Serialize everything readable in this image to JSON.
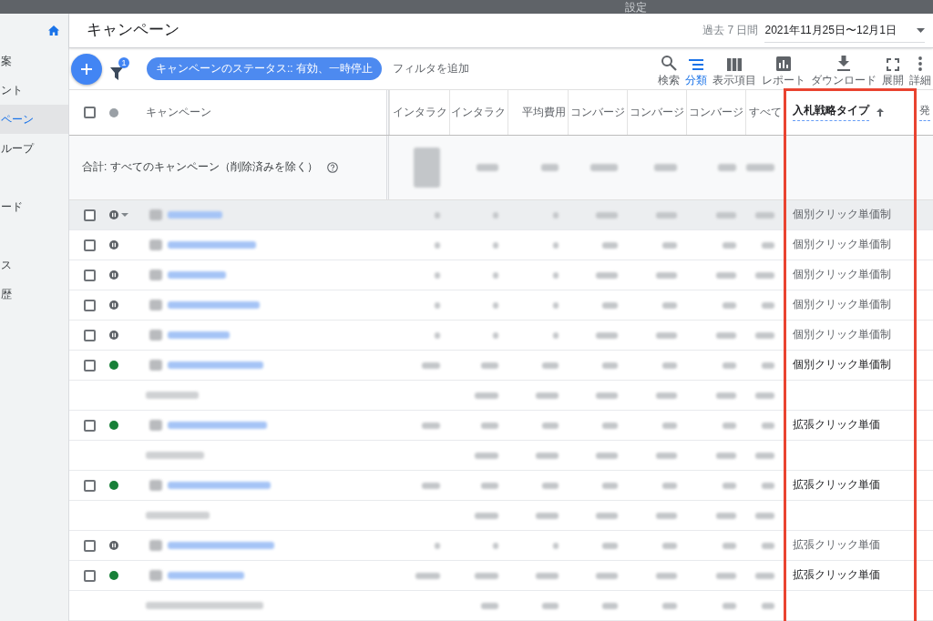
{
  "top_bar": {
    "label": "設定"
  },
  "sidebar": {
    "items": [
      {
        "label": "案",
        "selected": false
      },
      {
        "label": "ント",
        "selected": false
      },
      {
        "label": "ペーン",
        "selected": true
      },
      {
        "label": "ループ",
        "selected": false
      },
      {
        "label": "ード",
        "selected": false
      },
      {
        "label": "ス",
        "selected": false
      },
      {
        "label": "歴",
        "selected": false
      }
    ]
  },
  "header": {
    "title": "キャンペーン",
    "date_range": {
      "preset": "過去 7 日間",
      "value": "2021年11月25日〜12月1日"
    }
  },
  "toolbar": {
    "filter_badge": "1",
    "filter_chip": "キャンペーンのステータス:: 有効、一時停止",
    "add_filter": "フィルタを追加",
    "actions": [
      {
        "kind": "search",
        "label": "検索",
        "selected": false
      },
      {
        "kind": "segment",
        "label": "分類",
        "selected": true
      },
      {
        "kind": "columns",
        "label": "表示項目",
        "selected": false
      },
      {
        "kind": "report",
        "label": "レポート",
        "selected": false
      },
      {
        "kind": "download",
        "label": "ダウンロード",
        "selected": false
      },
      {
        "kind": "expand",
        "label": "展開",
        "selected": false
      },
      {
        "kind": "more",
        "label": "詳細",
        "selected": false
      }
    ]
  },
  "table": {
    "select_all": {
      "checked": false
    },
    "columns": [
      {
        "kind": "name",
        "label": "キャンペーン",
        "sorted": false,
        "help": false,
        "highlighted": false
      },
      {
        "kind": "metric",
        "label": "インタラク",
        "sorted": false,
        "help": false,
        "highlighted": false
      },
      {
        "kind": "metric",
        "label": "インタラク",
        "sorted": false,
        "help": false,
        "highlighted": false
      },
      {
        "kind": "metric",
        "label": "平均費用",
        "sorted": false,
        "help": false,
        "highlighted": false
      },
      {
        "kind": "metric",
        "label": "コンバージ",
        "sorted": false,
        "help": false,
        "highlighted": false
      },
      {
        "kind": "metric",
        "label": "コンバージ",
        "sorted": false,
        "help": false,
        "highlighted": false
      },
      {
        "kind": "metric",
        "label": "コンバージ",
        "sorted": false,
        "help": false,
        "highlighted": false
      },
      {
        "kind": "metric",
        "label": "すべて",
        "sorted": false,
        "help": false,
        "highlighted": false
      },
      {
        "kind": "text",
        "label": "入札戦略タイプ",
        "sorted": true,
        "help": true,
        "highlighted": true
      },
      {
        "kind": "text",
        "label": "発",
        "sorted": false,
        "help": true,
        "highlighted": false
      }
    ],
    "total_row": {
      "label": "合計: すべてのキャンペーン（削除済みを除く）"
    },
    "rows": [
      {
        "kind": "campaign",
        "paused": true,
        "checked": false,
        "hovered": true,
        "bid_strategy": "個別クリック単価制"
      },
      {
        "kind": "campaign",
        "paused": true,
        "checked": false,
        "hovered": false,
        "bid_strategy": "個別クリック単価制"
      },
      {
        "kind": "campaign",
        "paused": true,
        "checked": false,
        "hovered": false,
        "bid_strategy": "個別クリック単価制"
      },
      {
        "kind": "campaign",
        "paused": true,
        "checked": false,
        "hovered": false,
        "bid_strategy": "個別クリック単価制"
      },
      {
        "kind": "campaign",
        "paused": true,
        "checked": false,
        "hovered": false,
        "bid_strategy": "個別クリック単価制"
      },
      {
        "kind": "campaign",
        "paused": false,
        "checked": false,
        "hovered": false,
        "bid_strategy": "個別クリック単価制"
      },
      {
        "kind": "detail"
      },
      {
        "kind": "campaign",
        "paused": false,
        "checked": false,
        "hovered": false,
        "bid_strategy": "拡張クリック単価"
      },
      {
        "kind": "detail"
      },
      {
        "kind": "campaign",
        "paused": false,
        "checked": false,
        "hovered": false,
        "bid_strategy": "拡張クリック単価"
      },
      {
        "kind": "detail"
      },
      {
        "kind": "campaign",
        "paused": true,
        "checked": false,
        "hovered": false,
        "bid_strategy": "拡張クリック単価"
      },
      {
        "kind": "campaign",
        "paused": false,
        "checked": false,
        "hovered": false,
        "bid_strategy": "拡張クリック単価"
      },
      {
        "kind": "detail"
      }
    ]
  }
}
